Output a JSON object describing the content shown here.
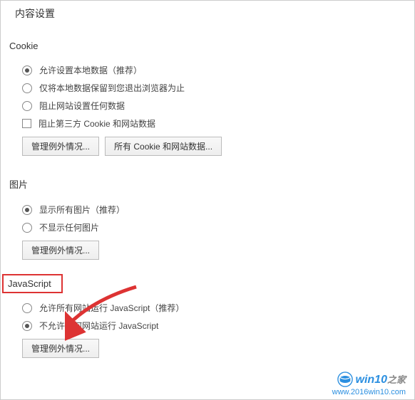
{
  "page_title": "内容设置",
  "sections": {
    "cookie": {
      "heading": "Cookie",
      "options": [
        {
          "label": "允许设置本地数据（推荐）",
          "type": "radio",
          "selected": true
        },
        {
          "label": "仅将本地数据保留到您退出浏览器为止",
          "type": "radio",
          "selected": false
        },
        {
          "label": "阻止网站设置任何数据",
          "type": "radio",
          "selected": false
        },
        {
          "label": "阻止第三方 Cookie 和网站数据",
          "type": "checkbox",
          "selected": false
        }
      ],
      "buttons": [
        "管理例外情况...",
        "所有 Cookie 和网站数据..."
      ]
    },
    "images": {
      "heading": "图片",
      "options": [
        {
          "label": "显示所有图片（推荐）",
          "type": "radio",
          "selected": true
        },
        {
          "label": "不显示任何图片",
          "type": "radio",
          "selected": false
        }
      ],
      "buttons": [
        "管理例外情况..."
      ]
    },
    "javascript": {
      "heading": "JavaScript",
      "options": [
        {
          "label": "允许所有网站运行 JavaScript（推荐）",
          "type": "radio",
          "selected": false
        },
        {
          "label": "不允许任何网站运行 JavaScript",
          "type": "radio",
          "selected": true
        }
      ],
      "buttons": [
        "管理例外情况..."
      ]
    }
  },
  "watermark": {
    "brand_prefix": "win10",
    "brand_suffix": "之家",
    "url": "www.2016win10.com"
  }
}
